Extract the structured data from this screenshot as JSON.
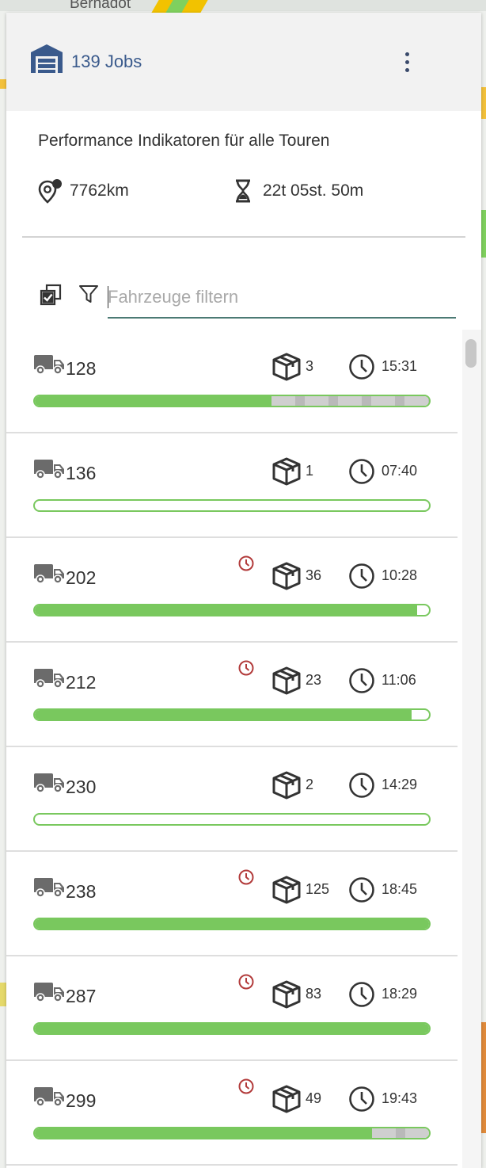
{
  "map": {
    "street_label": "Bernadot"
  },
  "header": {
    "jobs_label": "139 Jobs",
    "menu_icon": "more-vert-icon",
    "warehouse_icon": "warehouse-icon"
  },
  "kpi": {
    "title": "Performance Indikatoren für alle Touren",
    "distance": "7762km",
    "duration": "22t 05st. 50m"
  },
  "filter": {
    "placeholder": "Fahrzeuge filtern",
    "value": ""
  },
  "colors": {
    "accent": "#3a5a8c",
    "progress": "#79c85e",
    "late": "#b23a3a",
    "input_line": "#4c7a74"
  },
  "tours": [
    {
      "name": "128",
      "late": false,
      "jobs": "3",
      "time": "15:31",
      "progress": 0.6,
      "remaining_striped": true
    },
    {
      "name": "136",
      "late": false,
      "jobs": "1",
      "time": "07:40",
      "progress": 0.0,
      "remaining_striped": false
    },
    {
      "name": "202",
      "late": true,
      "jobs": "36",
      "time": "10:28",
      "progress": 0.97,
      "remaining_striped": false
    },
    {
      "name": "212",
      "late": true,
      "jobs": "23",
      "time": "11:06",
      "progress": 0.955,
      "remaining_striped": false
    },
    {
      "name": "230",
      "late": false,
      "jobs": "2",
      "time": "14:29",
      "progress": 0.0,
      "remaining_striped": false
    },
    {
      "name": "238",
      "late": true,
      "jobs": "125",
      "time": "18:45",
      "progress": 1.0,
      "remaining_striped": false
    },
    {
      "name": "287",
      "late": true,
      "jobs": "83",
      "time": "18:29",
      "progress": 1.0,
      "remaining_striped": false
    },
    {
      "name": "299",
      "late": true,
      "jobs": "49",
      "time": "19:43",
      "progress": 0.855,
      "remaining_striped": true
    }
  ]
}
